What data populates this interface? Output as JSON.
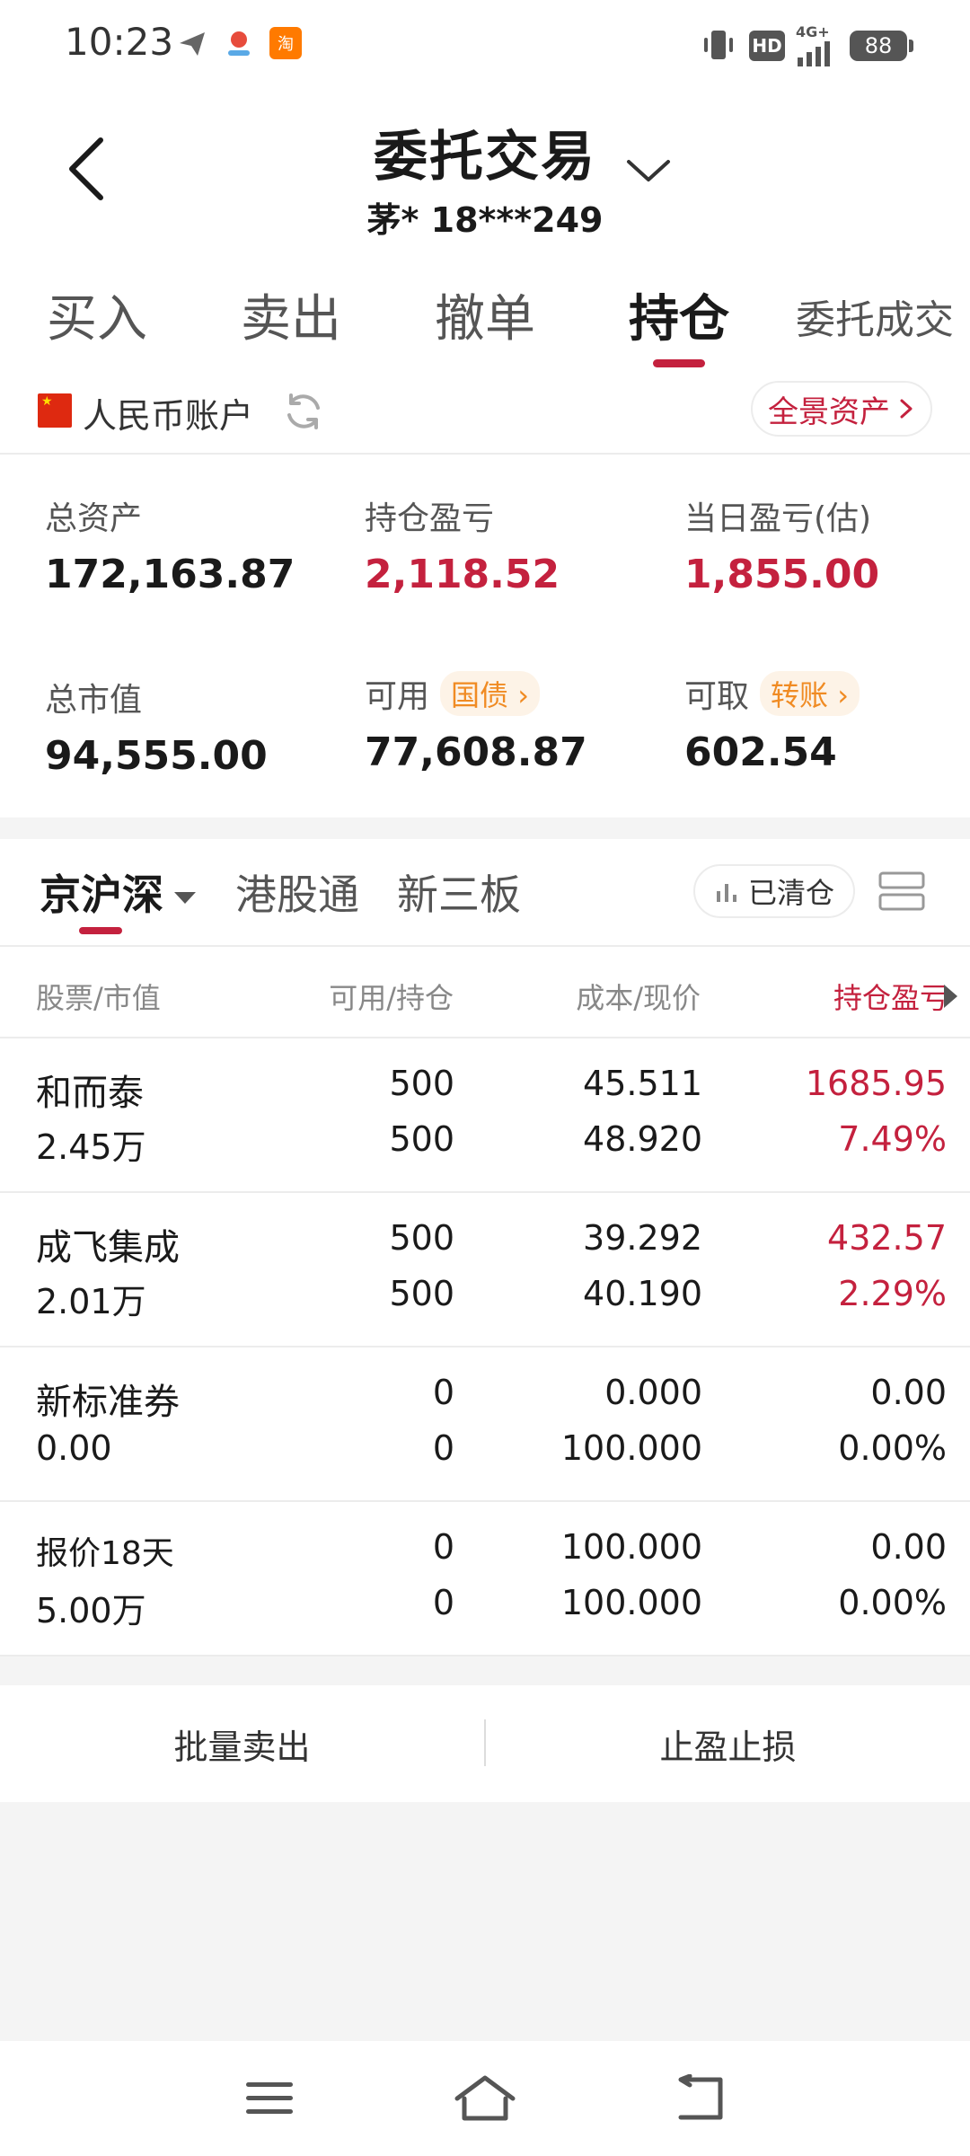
{
  "status_bar": {
    "time": "10:23",
    "battery": "88",
    "network": "4G+",
    "hd": "HD"
  },
  "header": {
    "title": "委托交易",
    "account_masked": "茅* 18***249"
  },
  "tabs": [
    {
      "label": "买入",
      "active": false
    },
    {
      "label": "卖出",
      "active": false
    },
    {
      "label": "撤单",
      "active": false
    },
    {
      "label": "持仓",
      "active": true
    },
    {
      "label": "委托成交",
      "active": false
    }
  ],
  "account": {
    "label": "人民币账户",
    "panorama_label": "全景资产"
  },
  "summary": {
    "total_assets": {
      "label": "总资产",
      "value": "172,163.87"
    },
    "position_pnl": {
      "label": "持仓盈亏",
      "value": "2,118.52"
    },
    "daily_pnl": {
      "label": "当日盈亏(估)",
      "value": "1,855.00"
    },
    "market_value": {
      "label": "总市值",
      "value": "94,555.00"
    },
    "available": {
      "label": "可用",
      "badge": "国债",
      "value": "77,608.87"
    },
    "withdrawable": {
      "label": "可取",
      "badge": "转账",
      "value": "602.54"
    }
  },
  "market_tabs": [
    {
      "label": "京沪深",
      "active": true
    },
    {
      "label": "港股通",
      "active": false
    },
    {
      "label": "新三板",
      "active": false
    }
  ],
  "cleared_label": "已清仓",
  "table": {
    "headers": [
      "股票/市值",
      "可用/持仓",
      "成本/现价",
      "持仓盈亏"
    ],
    "rows": [
      {
        "name": "和而泰",
        "market_value": "2.45万",
        "available": "500",
        "holding": "500",
        "cost": "45.511",
        "price": "48.920",
        "pnl": "1685.95",
        "pnl_pct": "7.49%",
        "positive": true
      },
      {
        "name": "成飞集成",
        "market_value": "2.01万",
        "available": "500",
        "holding": "500",
        "cost": "39.292",
        "price": "40.190",
        "pnl": "432.57",
        "pnl_pct": "2.29%",
        "positive": true
      },
      {
        "name": "新标准券",
        "market_value": "0.00",
        "available": "0",
        "holding": "0",
        "cost": "0.000",
        "price": "100.000",
        "pnl": "0.00",
        "pnl_pct": "0.00%",
        "positive": false
      },
      {
        "name": "报价18天",
        "market_value": "5.00万",
        "available": "0",
        "holding": "0",
        "cost": "100.000",
        "price": "100.000",
        "pnl": "0.00",
        "pnl_pct": "0.00%",
        "positive": false
      }
    ]
  },
  "actions": {
    "batch_sell": "批量卖出",
    "stop_profit_loss": "止盈止损"
  },
  "icons": {
    "back": "chevron-left-icon",
    "expand": "chevron-down-icon",
    "refresh": "refresh-icon",
    "layout": "layout-toggle-icon",
    "menu": "menu-icon",
    "home": "home-icon",
    "nav_back": "back-icon"
  },
  "colors": {
    "accent_red": "#c4213e",
    "badge_orange": "#f08b23",
    "background": "#f4f4f4"
  }
}
